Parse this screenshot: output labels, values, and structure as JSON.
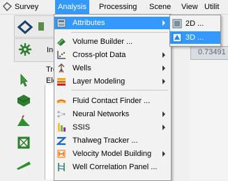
{
  "menubar": {
    "items": [
      {
        "label": "Survey",
        "active": false
      },
      {
        "label": "Analysis",
        "active": true
      },
      {
        "label": "Processing",
        "active": false
      },
      {
        "label": "Scene",
        "active": false
      },
      {
        "label": "View",
        "active": false
      },
      {
        "label": "Utilit",
        "active": false
      }
    ]
  },
  "background": {
    "partial_label_in": "In-",
    "partial_tab_tre": "Tre",
    "partial_tab_ele": "Ele",
    "partial_value": "0.73491"
  },
  "analysis_menu": {
    "items": [
      {
        "label": "Attributes",
        "icon": "attributes-icon",
        "submenu": true,
        "highlighted": true
      },
      {
        "label": "Volume Builder ...",
        "icon": "volume-builder-icon",
        "submenu": false
      },
      {
        "label": "Cross-plot Data",
        "icon": "crossplot-icon",
        "submenu": true
      },
      {
        "label": "Wells",
        "icon": "wells-icon",
        "submenu": true
      },
      {
        "label": "Layer Modeling",
        "icon": "layer-modeling-icon",
        "submenu": true
      },
      {
        "label": "Fluid Contact Finder ...",
        "icon": "fluid-contact-icon",
        "submenu": false
      },
      {
        "label": "Neural Networks",
        "icon": "neural-networks-icon",
        "submenu": true
      },
      {
        "label": "SSIS",
        "icon": "ssis-icon",
        "submenu": true
      },
      {
        "label": "Thalweg Tracker ...",
        "icon": "thalweg-icon",
        "submenu": false
      },
      {
        "label": "Velocity Model Building",
        "icon": "velocity-model-icon",
        "submenu": true
      },
      {
        "label": "Well Correlation Panel ...",
        "icon": "well-correlation-icon",
        "submenu": false
      }
    ]
  },
  "attributes_submenu": {
    "items": [
      {
        "label": "2D ...",
        "icon": "attr-2d-icon",
        "highlighted": false
      },
      {
        "label": "3D ...",
        "icon": "attr-3d-icon",
        "highlighted": true
      }
    ]
  }
}
